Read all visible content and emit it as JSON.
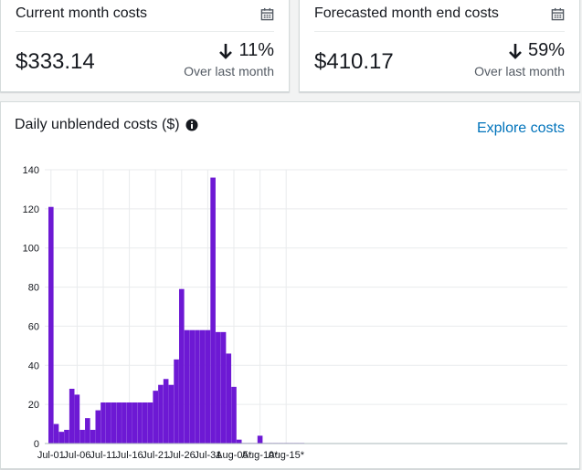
{
  "summary": {
    "current": {
      "title": "Current month costs",
      "value": "$333.14",
      "change": "11%",
      "change_direction": "down",
      "change_caption": "Over last month",
      "icon": "calendar-icon"
    },
    "forecast": {
      "title": "Forecasted month end costs",
      "value": "$410.17",
      "change": "59%",
      "change_direction": "down",
      "change_caption": "Over last month",
      "icon": "calendar-icon"
    }
  },
  "chart_panel": {
    "title": "Daily unblended costs ($)",
    "info_icon": "info-icon",
    "explore_label": "Explore costs"
  },
  "colors": {
    "bar": "#6d19d4",
    "link": "#0073bb",
    "grid": "#e9ebed"
  },
  "chart_data": {
    "type": "bar",
    "title": "Daily unblended costs ($)",
    "xlabel": "",
    "ylabel": "",
    "ylim": [
      0,
      140
    ],
    "yticks": [
      0,
      20,
      40,
      60,
      80,
      100,
      120,
      140
    ],
    "grid": true,
    "x_tick_labels": [
      "Jul-01",
      "Jul-06",
      "Jul-11",
      "Jul-16",
      "Jul-21",
      "Jul-26",
      "Jul-31",
      "Aug-05*",
      "Aug-10*",
      "Aug-15*"
    ],
    "x_tick_every": 5,
    "categories": [
      "Jul-01",
      "Jul-02",
      "Jul-03",
      "Jul-04",
      "Jul-05",
      "Jul-06",
      "Jul-07",
      "Jul-08",
      "Jul-09",
      "Jul-10",
      "Jul-11",
      "Jul-12",
      "Jul-13",
      "Jul-14",
      "Jul-15",
      "Jul-16",
      "Jul-17",
      "Jul-18",
      "Jul-19",
      "Jul-20",
      "Jul-21",
      "Jul-22",
      "Jul-23",
      "Jul-24",
      "Jul-25",
      "Jul-26",
      "Jul-27",
      "Jul-28",
      "Jul-29",
      "Jul-30",
      "Jul-31",
      "Aug-01",
      "Aug-02",
      "Aug-03",
      "Aug-04",
      "Aug-05*",
      "Aug-06*",
      "Aug-07*",
      "Aug-08*",
      "Aug-09*",
      "Aug-10*",
      "Aug-11*",
      "Aug-12*",
      "Aug-13*",
      "Aug-14*",
      "Aug-15*",
      "Aug-16*",
      "Aug-17*",
      "Aug-18*"
    ],
    "values": [
      121,
      10,
      6,
      7,
      28,
      25,
      7,
      13,
      7,
      17,
      21,
      21,
      21,
      21,
      21,
      21,
      21,
      21,
      21,
      21,
      27,
      30,
      33,
      30,
      43,
      79,
      58,
      58,
      58,
      58,
      58,
      136,
      57,
      57,
      46,
      29,
      2,
      0.3,
      0.3,
      0.3,
      4,
      0.3,
      0.3,
      0.3,
      0.3,
      0.3,
      0.3,
      0.3,
      0.3
    ]
  }
}
